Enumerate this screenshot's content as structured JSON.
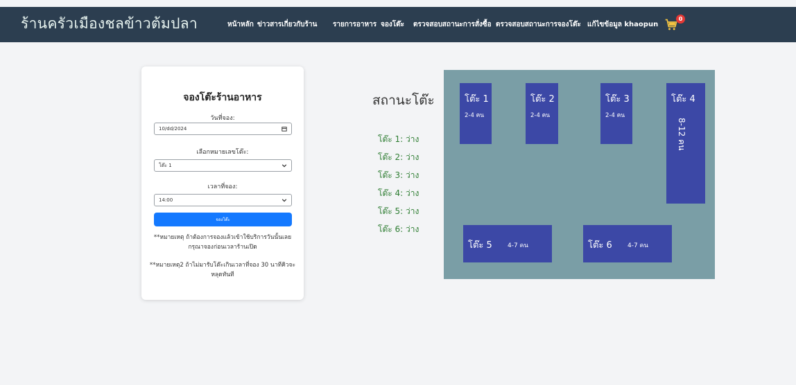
{
  "app": {
    "brand": "ร้านครัวเมืองชลข้าวต้มปลา",
    "cart_count": "0"
  },
  "nav": [
    {
      "label": "หน้าหลัก"
    },
    {
      "label": "ข่าวสารเกี่ยวกับร้าน"
    },
    {
      "label": "รายการอาหาร"
    },
    {
      "label": "จองโต๊ะ"
    },
    {
      "label": "ตรวจสอบสถานะการสั่งซื้อ"
    },
    {
      "label": "ตรวจสอบสถานะการจองโต๊ะ"
    },
    {
      "label": "แก้ไขข้อมูล khaopun"
    }
  ],
  "form": {
    "title": "จองโต๊ะร้านอาหาร",
    "date_label": "วันที่จอง:",
    "date_value": "10/dd/2024",
    "table_label": "เลือกหมายเลขโต๊ะ:",
    "table_value": "โต๊ะ 1",
    "time_label": "เวลาที่จอง:",
    "time_value": "14:00",
    "submit_label": "จองโต๊ะ",
    "note1": "**หมายเหตุ ถ้าต้องการจองแล้วเข้าใช้บริการวันนั้นเลยกรุณาจองก่อนเวลาร้านเปิด",
    "note2": "**หมายเหตุ2 ถ้าไม่มารับโต๊ะเกินเวลาที่จอง 30 นาทีคิวจะหลุดทันที"
  },
  "status": {
    "title": "สถานะโต๊ะ",
    "lines": [
      "โต๊ะ 1: ว่าง",
      "โต๊ะ 2: ว่าง",
      "โต๊ะ 3: ว่าง",
      "โต๊ะ 4: ว่าง",
      "โต๊ะ 5: ว่าง",
      "โต๊ะ 6: ว่าง"
    ]
  },
  "tables": [
    {
      "name": "โต๊ะ 1",
      "capacity": "2-4 คน"
    },
    {
      "name": "โต๊ะ 2",
      "capacity": "2-4 คน"
    },
    {
      "name": "โต๊ะ 3",
      "capacity": "2-4 คน"
    },
    {
      "name": "โต๊ะ 4",
      "capacity": "8-12 คน"
    },
    {
      "name": "โต๊ะ 5",
      "capacity": "4-7 คน"
    },
    {
      "name": "โต๊ะ 6",
      "capacity": "4-7 คน"
    }
  ],
  "colors": {
    "navbar": "#2c3e50",
    "floor": "#7a9ea6",
    "table": "#3c48a6",
    "button": "#1479ff",
    "available": "#2e7d32",
    "badge": "#e53935"
  },
  "icons": {
    "cart": "shopping-cart-icon",
    "calendar": "calendar-icon",
    "chevron": "chevron-down-icon"
  }
}
